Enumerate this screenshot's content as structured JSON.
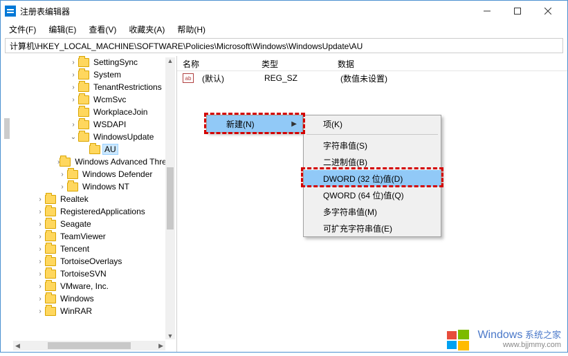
{
  "window": {
    "title": "注册表编辑器"
  },
  "menu": {
    "file": "文件(F)",
    "edit": "编辑(E)",
    "view": "查看(V)",
    "favorites": "收藏夹(A)",
    "help": "帮助(H)"
  },
  "path": "计算机\\HKEY_LOCAL_MACHINE\\SOFTWARE\\Policies\\Microsoft\\Windows\\WindowsUpdate\\AU",
  "tree": [
    {
      "indent": 5,
      "tw": ">",
      "label": "SettingSync"
    },
    {
      "indent": 5,
      "tw": ">",
      "label": "System"
    },
    {
      "indent": 5,
      "tw": ">",
      "label": "TenantRestrictions"
    },
    {
      "indent": 5,
      "tw": ">",
      "label": "WcmSvc"
    },
    {
      "indent": 5,
      "tw": "",
      "label": "WorkplaceJoin"
    },
    {
      "indent": 5,
      "tw": ">",
      "label": "WSDAPI"
    },
    {
      "indent": 5,
      "tw": "v",
      "label": "WindowsUpdate"
    },
    {
      "indent": 6,
      "tw": "",
      "label": "AU",
      "selected": true
    },
    {
      "indent": 4,
      "tw": ">",
      "label": "Windows Advanced Threat Protection"
    },
    {
      "indent": 4,
      "tw": ">",
      "label": "Windows Defender"
    },
    {
      "indent": 4,
      "tw": ">",
      "label": "Windows NT"
    },
    {
      "indent": 2,
      "tw": ">",
      "label": "Realtek"
    },
    {
      "indent": 2,
      "tw": ">",
      "label": "RegisteredApplications"
    },
    {
      "indent": 2,
      "tw": ">",
      "label": "Seagate"
    },
    {
      "indent": 2,
      "tw": ">",
      "label": "TeamViewer"
    },
    {
      "indent": 2,
      "tw": ">",
      "label": "Tencent"
    },
    {
      "indent": 2,
      "tw": ">",
      "label": "TortoiseOverlays"
    },
    {
      "indent": 2,
      "tw": ">",
      "label": "TortoiseSVN"
    },
    {
      "indent": 2,
      "tw": ">",
      "label": "VMware, Inc."
    },
    {
      "indent": 2,
      "tw": ">",
      "label": "Windows"
    },
    {
      "indent": 2,
      "tw": ">",
      "label": "WinRAR"
    }
  ],
  "cols": {
    "name": "名称",
    "type": "类型",
    "data": "数据"
  },
  "rows": [
    {
      "name": "(默认)",
      "type": "REG_SZ",
      "data": "(数值未设置)"
    }
  ],
  "ctx1": {
    "new": "新建(N)"
  },
  "ctx2": {
    "key": "项(K)",
    "string": "字符串值(S)",
    "binary": "二进制值(B)",
    "dword": "DWORD (32 位)值(D)",
    "qword": "QWORD (64 位)值(Q)",
    "multi": "多字符串值(M)",
    "expand": "可扩充字符串值(E)"
  },
  "watermark": {
    "brand": "Windows",
    "sub": "系统之家",
    "url": "www.bjjmmy.com"
  }
}
